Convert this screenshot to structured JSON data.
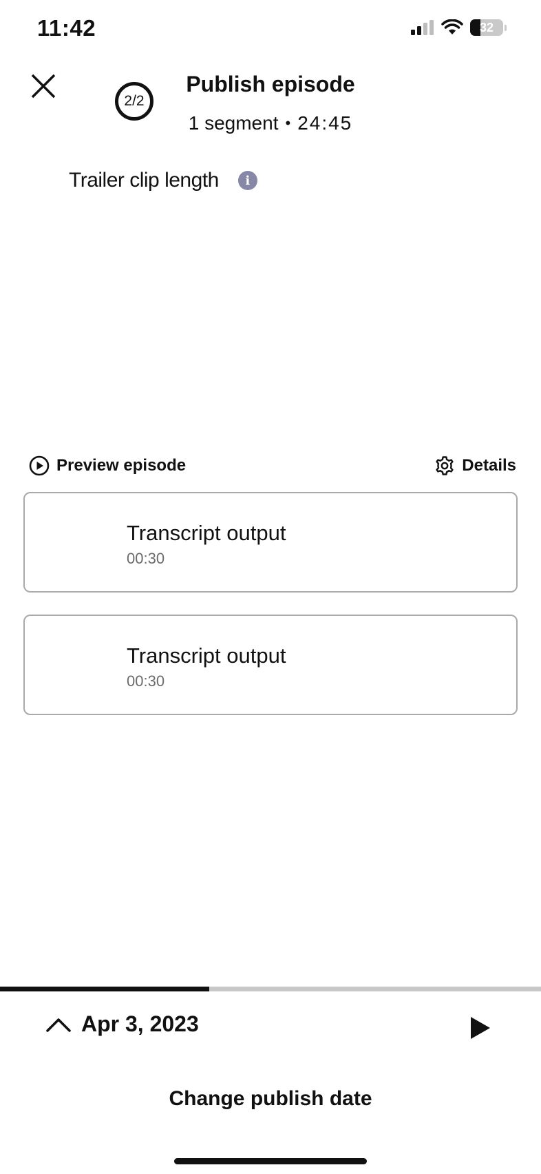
{
  "status_bar": {
    "time": "11:42",
    "battery_level": "32",
    "icons": [
      "signal-icon",
      "wifi-icon",
      "battery-icon"
    ]
  },
  "header": {
    "close_icon": "close-icon",
    "step": "2/2",
    "title": "Publish episode",
    "segments": "1 segment",
    "separator": "•",
    "duration": "24:45"
  },
  "trailer": {
    "label": "Trailer clip length",
    "info_icon": "info-icon",
    "info_glyph": "i"
  },
  "actions": {
    "preview_label": "Preview episode",
    "details_label": "Details"
  },
  "segments": [
    {
      "title": "Transcript output",
      "time": "00:30"
    },
    {
      "title": "Transcript output",
      "time": "00:30"
    }
  ],
  "footer": {
    "progress": 0.387,
    "date": "Apr 3, 2023",
    "change_date_label": "Change publish date"
  },
  "colors": {
    "accent": "#111111",
    "info": "#8787a8",
    "card_border": "#a9a9a9",
    "progress_track": "#c8c8c8"
  }
}
